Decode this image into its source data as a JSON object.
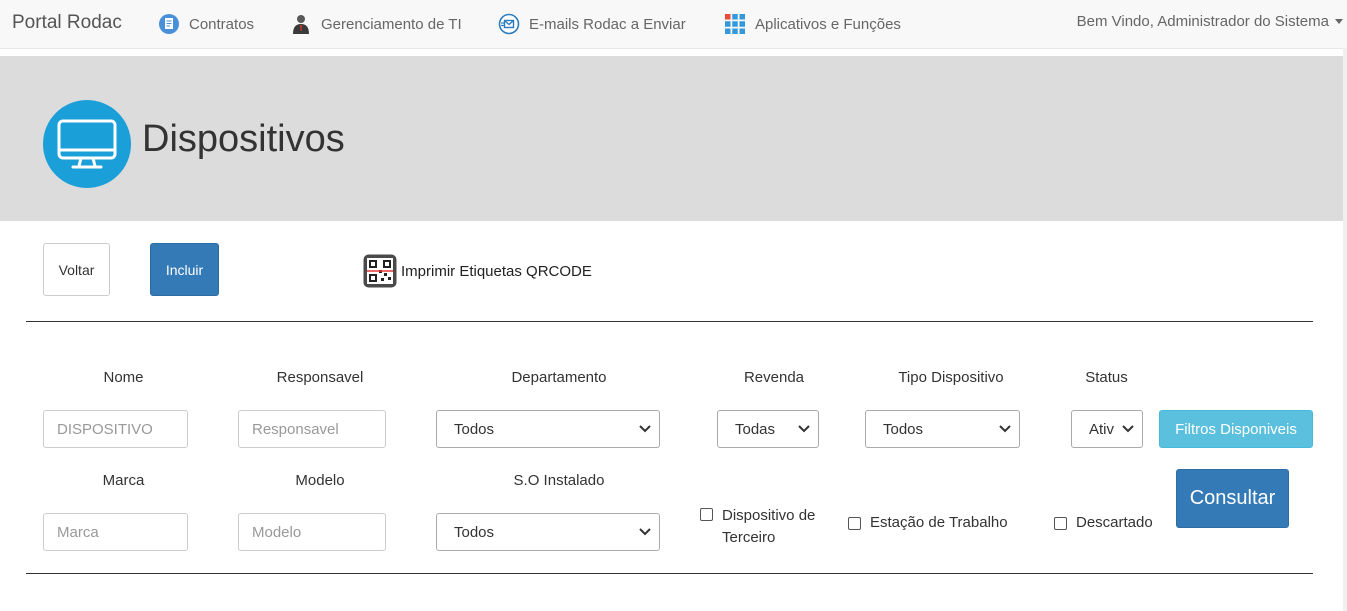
{
  "navbar": {
    "brand": "Portal Rodac",
    "items": [
      {
        "label": "Contratos",
        "icon": "contract-icon"
      },
      {
        "label": "Gerenciamento de TI",
        "icon": "user-manager-icon"
      },
      {
        "label": "E-mails Rodac a Enviar",
        "icon": "email-icon"
      },
      {
        "label": "Aplicativos e Funções",
        "icon": "apps-grid-icon"
      }
    ],
    "user_menu": "Bem Vindo, Administrador do Sistema"
  },
  "header": {
    "title": "Dispositivos",
    "icon": "monitor-icon",
    "accent_color": "#1a9fd9"
  },
  "toolbar": {
    "back_label": "Voltar",
    "add_label": "Incluir",
    "print_qr_label": "Imprimir Etiquetas QRCODE",
    "print_qr_icon": "qrcode-icon"
  },
  "filters": {
    "nome": {
      "label": "Nome",
      "placeholder": "DISPOSITIVO"
    },
    "responsavel": {
      "label": "Responsavel",
      "placeholder": "Responsavel"
    },
    "departamento": {
      "label": "Departamento",
      "value": "Todos"
    },
    "revenda": {
      "label": "Revenda",
      "value": "Todas"
    },
    "tipo_dispositivo": {
      "label": "Tipo Dispositivo",
      "value": "Todos"
    },
    "status": {
      "label": "Status",
      "value": "Ativ"
    },
    "available_filters_label": "Filtros Disponiveis",
    "marca": {
      "label": "Marca",
      "placeholder": "Marca"
    },
    "modelo": {
      "label": "Modelo",
      "placeholder": "Modelo"
    },
    "so_instalado": {
      "label": "S.O Instalado",
      "value": "Todos"
    },
    "terceiro": {
      "line1": "Dispositivo de",
      "line2": "Terceiro",
      "checked": false
    },
    "estacao": {
      "label": "Estação de Trabalho",
      "checked": false
    },
    "descartado": {
      "label": "Descartado",
      "checked": false
    },
    "submit_label": "Consultar"
  },
  "colors": {
    "primary": "#337ab7",
    "info": "#5bc0de",
    "jumbotron": "#dcdcdc"
  }
}
